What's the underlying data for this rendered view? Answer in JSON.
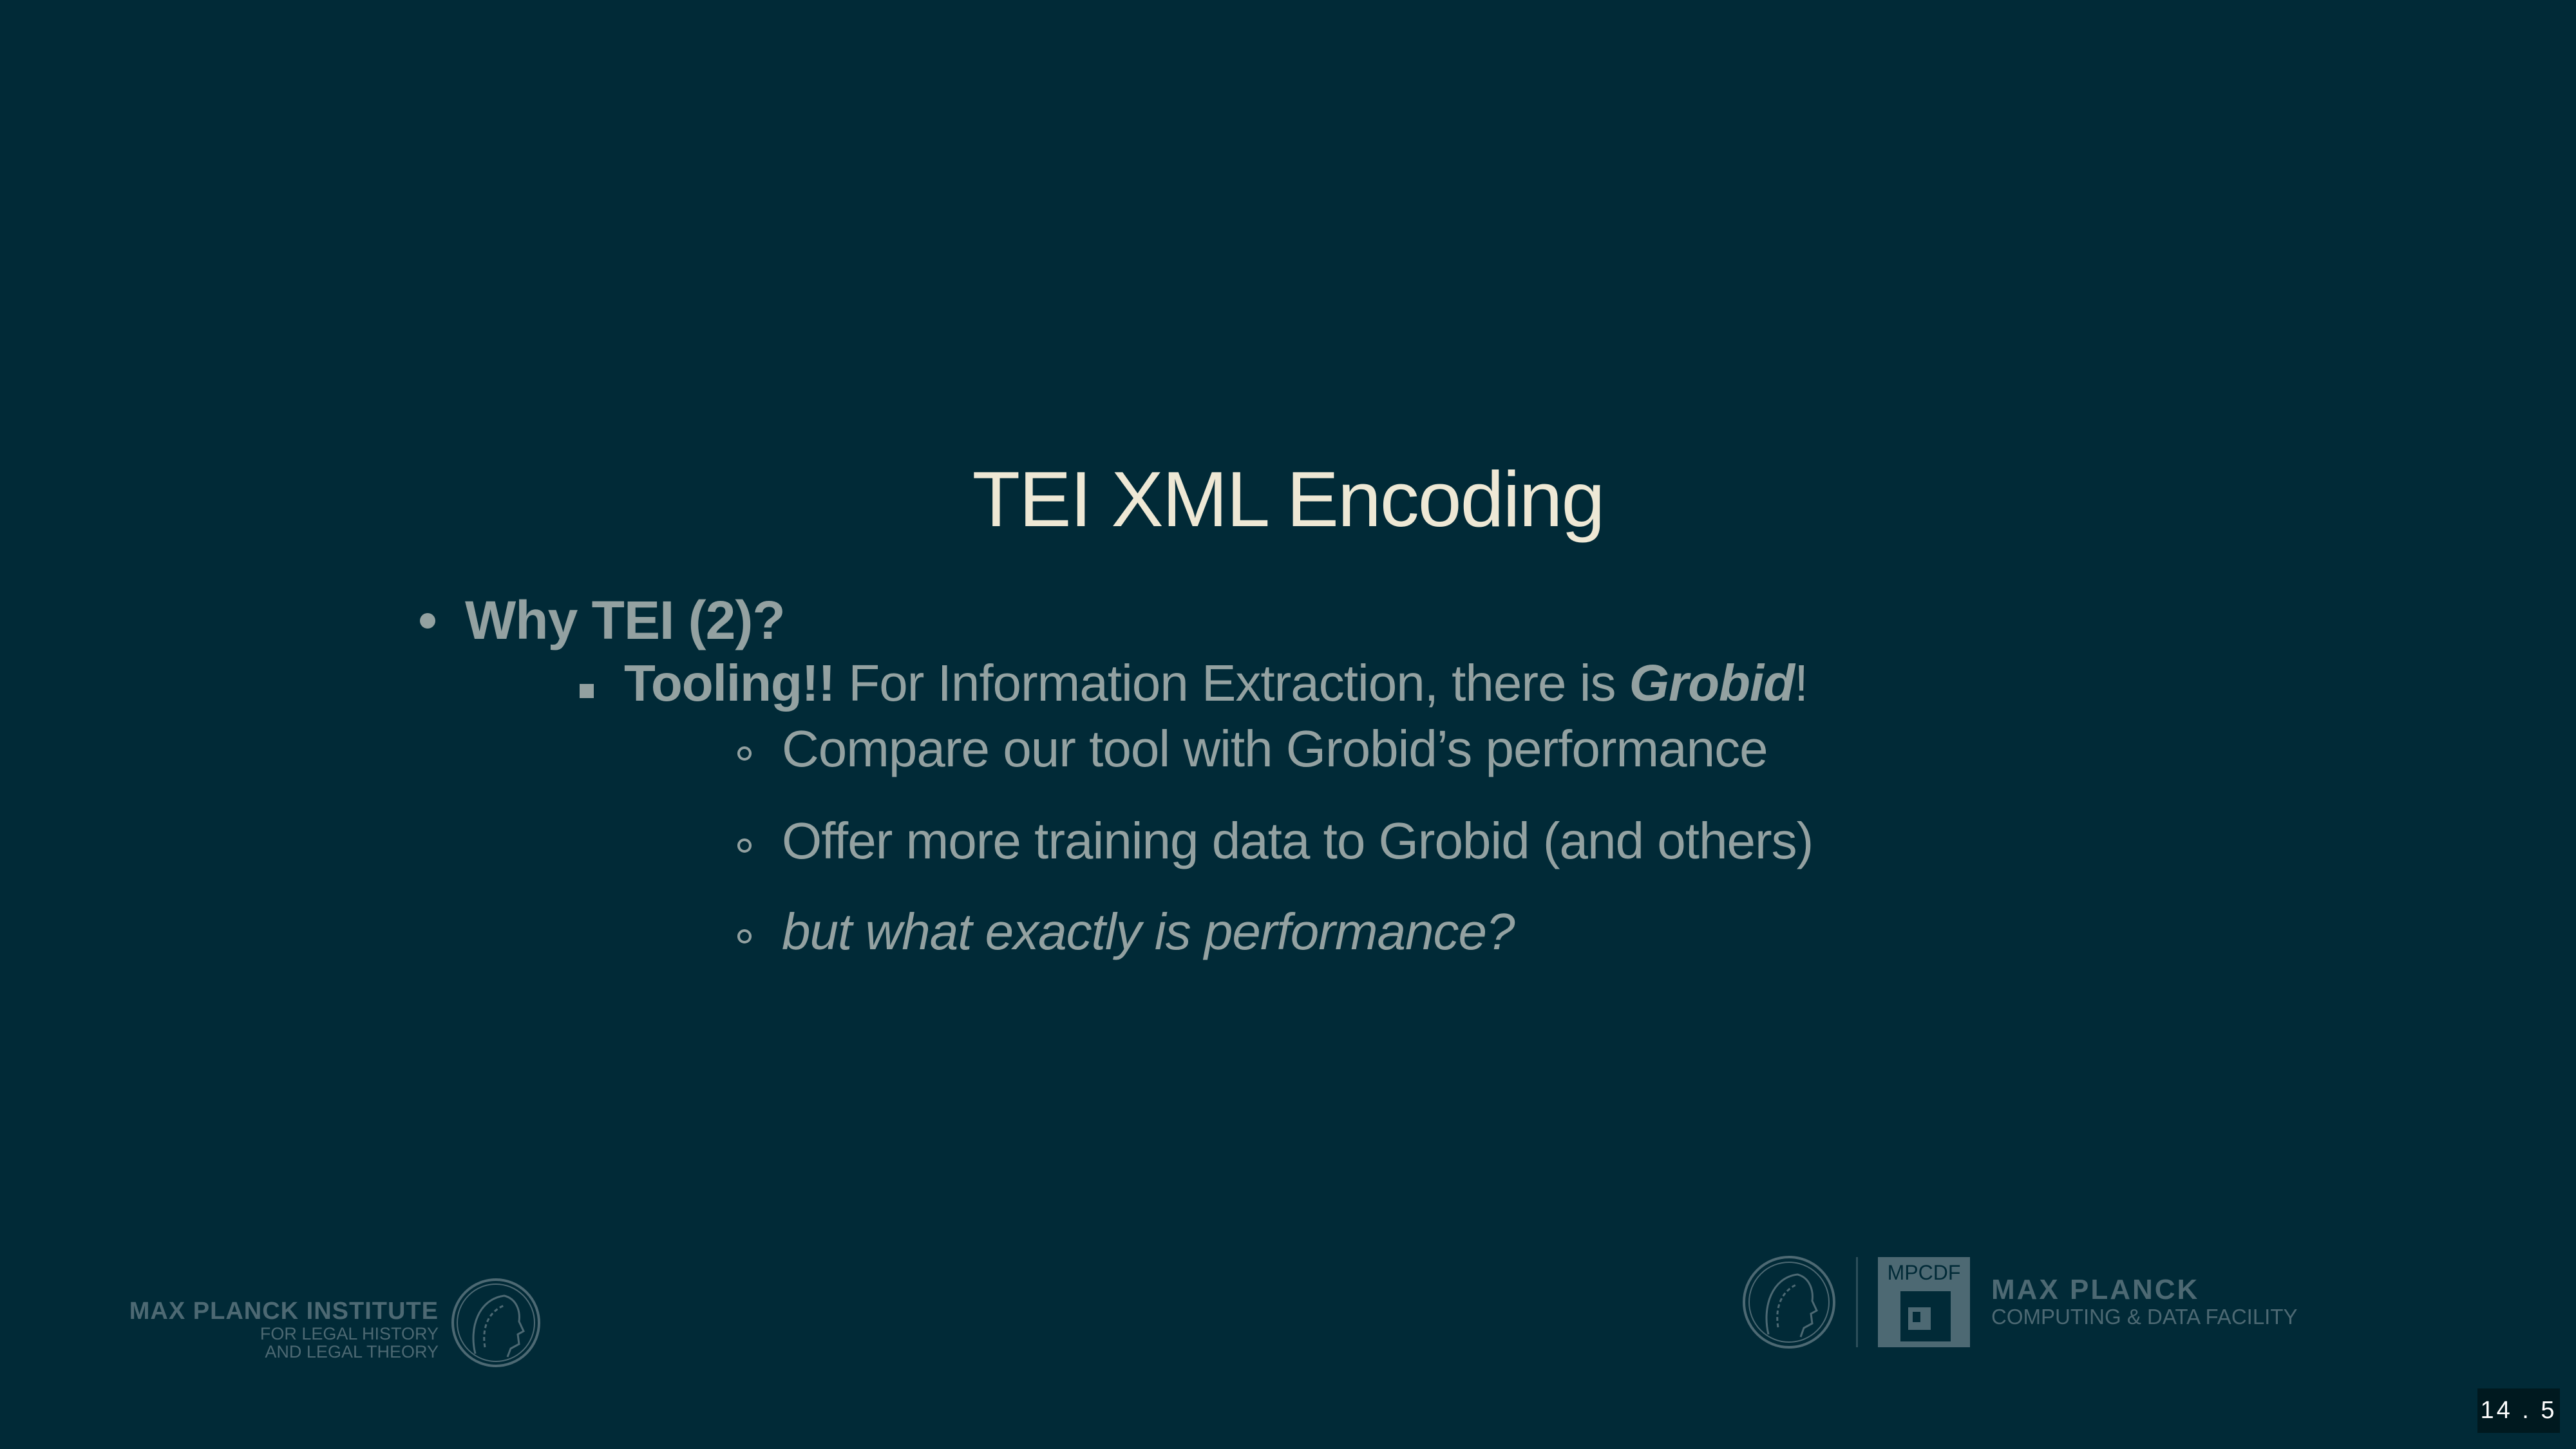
{
  "slide": {
    "title": "TEI XML Encoding",
    "level1": "Why TEI (2)?",
    "level2": {
      "bold": "Tooling!!",
      "text": " For Information Extraction, there is ",
      "emph": "Grobid",
      "end": "!"
    },
    "level3": [
      "Compare our tool with Grobid’s performance",
      "Offer more training data to Grobid (and others)",
      "but what exactly is performance?"
    ]
  },
  "footer": {
    "left_logo": {
      "line1": "MAX PLANCK INSTITUTE",
      "line2": "FOR LEGAL HISTORY",
      "line3": "AND LEGAL THEORY"
    },
    "right_logo": {
      "box_label": "MPCDF",
      "line1": "MAX PLANCK",
      "line2": "COMPUTING & DATA FACILITY"
    },
    "page_number": "14 . 5"
  },
  "colors": {
    "background": "#012a37",
    "title": "#eee8d5",
    "body": "#93a1a1",
    "logo": "#4d6973"
  }
}
